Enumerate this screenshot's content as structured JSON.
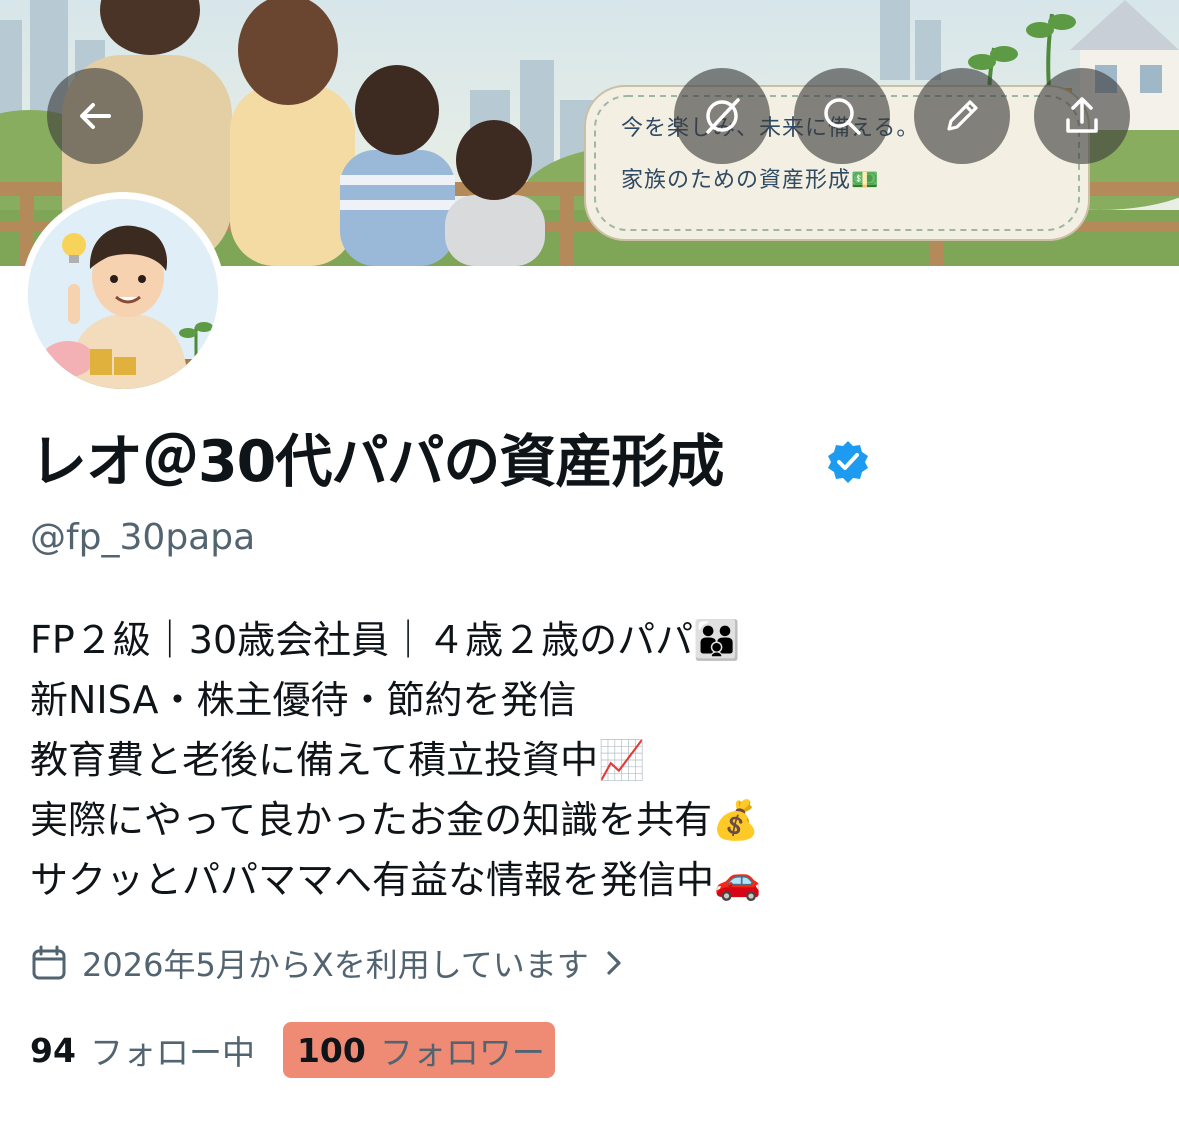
{
  "banner": {
    "sign_line1": "今を楽しみ、未来に備える。",
    "sign_line2": "家族のための資産形成💵"
  },
  "toolbar": {
    "back_icon": "arrow-left-icon",
    "grok_icon": "grok-icon",
    "search_icon": "search-icon",
    "edit_icon": "pencil-icon",
    "share_icon": "share-icon"
  },
  "profile": {
    "display_name": "レオ＠30代パパの資産形成",
    "handle": "@fp_30papa",
    "verified_color": "#1d9bf0",
    "bio": [
      "FP２級｜30歳会社員｜４歳２歳のパパ👪",
      "新NISA・株主優待・節約を発信",
      "教育費と老後に備えて積立投資中📈",
      "実際にやって良かったお金の知識を共有💰",
      "サクッとパパママへ有益な情報を発信中🚗"
    ],
    "joined": "2026年5月からXを利用しています"
  },
  "stats": {
    "following_count": "94",
    "following_label": "フォロー中",
    "followers_count": "100",
    "followers_label": "フォロワー",
    "highlight_color": "#ef8b74"
  }
}
